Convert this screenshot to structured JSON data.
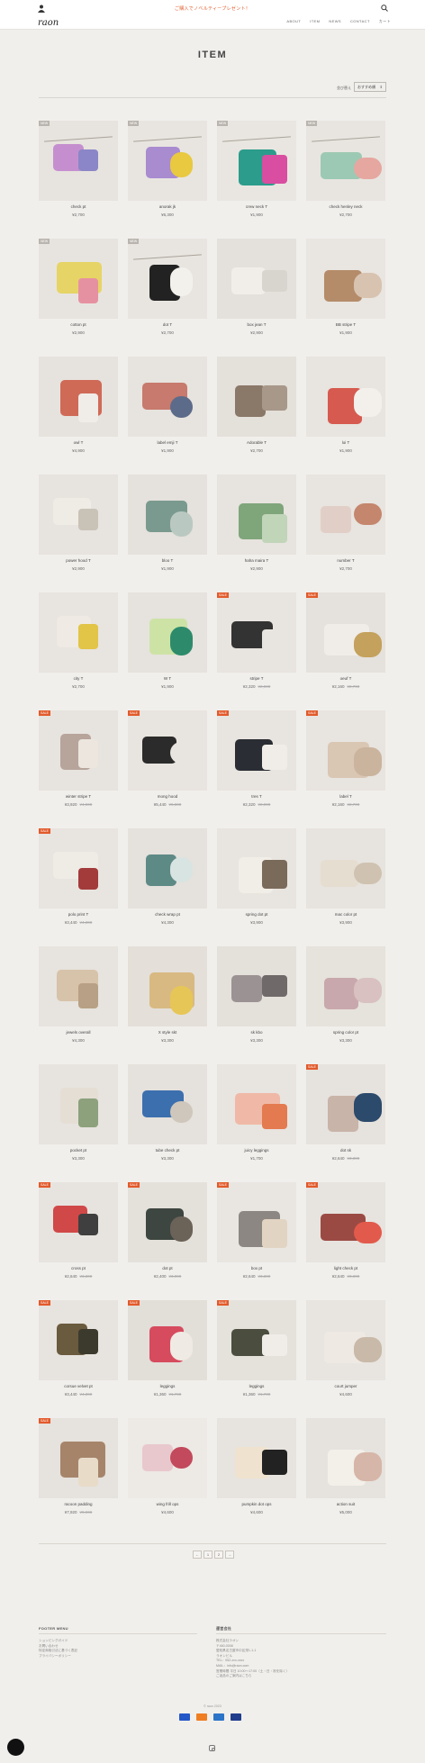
{
  "header": {
    "logo": "raon",
    "promo": "ご購入でノベルティープレゼント！",
    "nav": [
      "ABOUT",
      "ITEM",
      "NEWS",
      "CONTACT",
      "カート"
    ],
    "icons": [
      "user-icon",
      "search-icon"
    ]
  },
  "page": {
    "title": "ITEM",
    "sort_label": "並び替え",
    "sort_value": "おすすめ順"
  },
  "products": [
    {
      "name": "check pt",
      "price": "¥2,700",
      "badge": "NEW",
      "colors": [
        "#e7e3de",
        "#c58fcf",
        "#8b86c7"
      ]
    },
    {
      "name": "anorak jk",
      "price": "¥6,300",
      "badge": "NEW",
      "colors": [
        "#e8e5e0",
        "#a98bd0",
        "#e8c93f"
      ]
    },
    {
      "name": "crew neck T",
      "price": "¥1,900",
      "badge": "NEW",
      "colors": [
        "#e9e6e1",
        "#2c9c8c",
        "#d94ea0"
      ]
    },
    {
      "name": "check henley neck",
      "price": "¥2,700",
      "badge": "NEW",
      "colors": [
        "#e8e5e0",
        "#9cc9b3",
        "#e5a7a0"
      ]
    },
    {
      "name": "cotton pt",
      "price": "¥2,900",
      "badge": "NEW",
      "colors": [
        "#e7e4df",
        "#e6d466",
        "#e691a1"
      ]
    },
    {
      "name": "dot T",
      "price": "¥2,700",
      "badge": "NEW",
      "colors": [
        "#e8e5e0",
        "#222222",
        "#f3f1ec"
      ]
    },
    {
      "name": "box jean T",
      "price": "¥2,900",
      "badge": "",
      "colors": [
        "#e4e1dc",
        "#f1eeea",
        "#d8d4ce"
      ]
    },
    {
      "name": "BB stripe T",
      "price": "¥1,900",
      "badge": "",
      "colors": [
        "#e9e5e0",
        "#b48c6a",
        "#d8c3b0"
      ]
    },
    {
      "name": "owl T",
      "price": "¥4,900",
      "badge": "",
      "colors": [
        "#e6e2dd",
        "#cf6a57",
        "#f0ece7"
      ]
    },
    {
      "name": "label emji T",
      "price": "¥1,900",
      "badge": "",
      "colors": [
        "#e7e3de",
        "#c77a6d",
        "#5d6b8a"
      ]
    },
    {
      "name": "Adorable T",
      "price": "¥2,700",
      "badge": "",
      "colors": [
        "#e4e0da",
        "#8a7868",
        "#a8988a"
      ]
    },
    {
      "name": "loi T",
      "price": "¥1,900",
      "badge": "",
      "colors": [
        "#e8e4df",
        "#d65a4f",
        "#f3efea"
      ]
    },
    {
      "name": "power hood T",
      "price": "¥2,900",
      "badge": "",
      "colors": [
        "#e7e3de",
        "#efebe5",
        "#c9c2b7"
      ]
    },
    {
      "name": "bloo T",
      "price": "¥1,900",
      "badge": "",
      "colors": [
        "#e5e1dc",
        "#7a9a8f",
        "#b9c9c1"
      ]
    },
    {
      "name": "haha maira T",
      "price": "¥2,900",
      "badge": "",
      "colors": [
        "#e7e3de",
        "#7fa57b",
        "#c1d5b9"
      ]
    },
    {
      "name": "number T",
      "price": "¥2,700",
      "badge": "",
      "colors": [
        "#e8e4df",
        "#e1cfc7",
        "#c4866d"
      ]
    },
    {
      "name": "city T",
      "price": "¥2,700",
      "badge": "",
      "colors": [
        "#e8e4df",
        "#efeae4",
        "#e2c447"
      ]
    },
    {
      "name": "W T",
      "price": "¥1,900",
      "badge": "",
      "colors": [
        "#e6e2dd",
        "#cde3a6",
        "#2d8b6c"
      ]
    },
    {
      "name": "stripe T",
      "price": "¥2,320",
      "old": "¥2,900",
      "badge": "SALE",
      "colors": [
        "#e8e4df",
        "#333333",
        "#e8e4df"
      ]
    },
    {
      "name": "oeuf T",
      "price": "¥2,160",
      "old": "¥2,700",
      "badge": "SALE",
      "colors": [
        "#e5e1dc",
        "#f0ede8",
        "#c4a15c"
      ]
    },
    {
      "name": "winter stripe T",
      "price": "¥3,920",
      "old": "¥4,900",
      "badge": "SALE",
      "colors": [
        "#e7e3de",
        "#b7a49b",
        "#ece6df"
      ]
    },
    {
      "name": "mong hood",
      "price": "¥5,440",
      "old": "¥6,800",
      "badge": "SALE",
      "colors": [
        "#e8e4df",
        "#2b2b2b",
        "#e8e4df"
      ]
    },
    {
      "name": "tres T",
      "price": "¥2,320",
      "old": "¥2,900",
      "badge": "SALE",
      "colors": [
        "#e8e4df",
        "#2a2d33",
        "#f0ede8"
      ]
    },
    {
      "name": "label T",
      "price": "¥2,160",
      "old": "¥2,700",
      "badge": "SALE",
      "colors": [
        "#e8e4df",
        "#d9c6b3",
        "#cbb49e"
      ]
    },
    {
      "name": "polo print T",
      "price": "¥3,440",
      "old": "¥4,300",
      "badge": "SALE",
      "colors": [
        "#e8e4df",
        "#efebe5",
        "#a33b3b"
      ]
    },
    {
      "name": "check wrap pt",
      "price": "¥4,300",
      "badge": "",
      "colors": [
        "#e5e1dc",
        "#5e8a86",
        "#d8e4e1"
      ]
    },
    {
      "name": "spring dot pt",
      "price": "¥3,900",
      "badge": "",
      "colors": [
        "#e8e4df",
        "#f1ede7",
        "#7a6a5a"
      ]
    },
    {
      "name": "mac color pt",
      "price": "¥3,900",
      "badge": "",
      "colors": [
        "#e7e3de",
        "#e6ddd1",
        "#cfc2b1"
      ]
    },
    {
      "name": "jewels overall",
      "price": "¥4,300",
      "badge": "",
      "colors": [
        "#e7e3de",
        "#d7c3a9",
        "#b7a085"
      ]
    },
    {
      "name": "X style skt",
      "price": "¥3,300",
      "badge": "",
      "colors": [
        "#e4dfd8",
        "#d9b982",
        "#e6c657"
      ]
    },
    {
      "name": "sk kbo",
      "price": "¥3,300",
      "badge": "",
      "colors": [
        "#e4e0da",
        "#9b9393",
        "#6f6a69"
      ]
    },
    {
      "name": "spring color pt",
      "price": "¥3,300",
      "badge": "",
      "colors": [
        "#e6e2dc",
        "#c8a8ac",
        "#d8c1c0"
      ]
    },
    {
      "name": "pocket pt",
      "price": "¥3,300",
      "badge": "",
      "colors": [
        "#e7e3de",
        "#e5ded5",
        "#8ca17c"
      ]
    },
    {
      "name": "tube check pt",
      "price": "¥3,300",
      "badge": "",
      "colors": [
        "#e5e1dc",
        "#3c6fae",
        "#cfc7bb"
      ]
    },
    {
      "name": "juicy leggings",
      "price": "¥1,700",
      "badge": "",
      "colors": [
        "#e8e4df",
        "#f0b9a7",
        "#e47a4f"
      ]
    },
    {
      "name": "dot sk",
      "price": "¥2,640",
      "old": "¥3,300",
      "badge": "SALE",
      "colors": [
        "#e6e2dd",
        "#c9b4a9",
        "#2c4a6b"
      ]
    },
    {
      "name": "cross pt",
      "price": "¥2,640",
      "old": "¥3,300",
      "badge": "SALE",
      "colors": [
        "#e7e3de",
        "#d04848",
        "#3f3f3f"
      ]
    },
    {
      "name": "dot pt",
      "price": "¥2,400",
      "old": "¥3,000",
      "badge": "SALE",
      "colors": [
        "#e4e0da",
        "#3d4640",
        "#6b6258"
      ]
    },
    {
      "name": "box pt",
      "price": "¥2,640",
      "old": "¥3,300",
      "badge": "SALE",
      "colors": [
        "#e9e6e1",
        "#8c8782",
        "#e2d4c2"
      ]
    },
    {
      "name": "light check pt",
      "price": "¥2,640",
      "old": "¥3,300",
      "badge": "SALE",
      "colors": [
        "#e7e3de",
        "#9a4a43",
        "#e25a4b"
      ]
    },
    {
      "name": "corsue velvet pt",
      "price": "¥3,440",
      "old": "¥4,300",
      "badge": "SALE",
      "colors": [
        "#e7e3de",
        "#6a5a3e",
        "#3c3a2d"
      ]
    },
    {
      "name": "leggings",
      "price": "¥1,360",
      "old": "¥1,700",
      "badge": "SALE",
      "colors": [
        "#e2ded8",
        "#d64b5e",
        "#efeae3"
      ]
    },
    {
      "name": "leggings",
      "price": "¥1,360",
      "old": "¥1,700",
      "badge": "SALE",
      "colors": [
        "#e5e1db",
        "#4b4e3f",
        "#f0ede8"
      ]
    },
    {
      "name": "court jumper",
      "price": "¥4,600",
      "badge": "",
      "colors": [
        "#e8e4df",
        "#eee9e2",
        "#c9b9a8"
      ]
    },
    {
      "name": "racoon padding",
      "price": "¥7,920",
      "old": "¥9,900",
      "badge": "SALE",
      "colors": [
        "#e6e2dd",
        "#a6846a",
        "#e8dcc9"
      ]
    },
    {
      "name": "wing frill ops",
      "price": "¥4,600",
      "badge": "",
      "colors": [
        "#ede9e4",
        "#e8c8cc",
        "#c24a5c"
      ]
    },
    {
      "name": "pumpkin dot ops",
      "price": "¥4,600",
      "badge": "",
      "colors": [
        "#e7e3de",
        "#efe3cf",
        "#222222"
      ]
    },
    {
      "name": "action suit",
      "price": "¥5,000",
      "badge": "",
      "colors": [
        "#e6e2dd",
        "#f3efe9",
        "#d6b6a8"
      ]
    }
  ],
  "pagination": [
    "←",
    "1",
    "2",
    "→"
  ],
  "footer": {
    "left_title": "FOOTER MENU",
    "left_items": [
      "ショッピングガイド",
      "お問い合わせ",
      "特定商取引法に基づく表記",
      "プライバシーポリシー"
    ],
    "right_title": "運営会社",
    "right_items": [
      "株式会社ラオン",
      "〒460-0008",
      "愛知県名古屋市中区栄1-1-1",
      "ラオンビル",
      "TEL：052-xxx-xxxx",
      "MAIL：info@raon.com",
      "営業時間 平日 10:00〜17:00（土・日・祝を除く）",
      "ご返品のご案内はこちら"
    ],
    "copyright": "© raon 2023",
    "payments": [
      "#2357c8",
      "#ef7d22",
      "#2b74c7",
      "#1f3d8c"
    ]
  }
}
